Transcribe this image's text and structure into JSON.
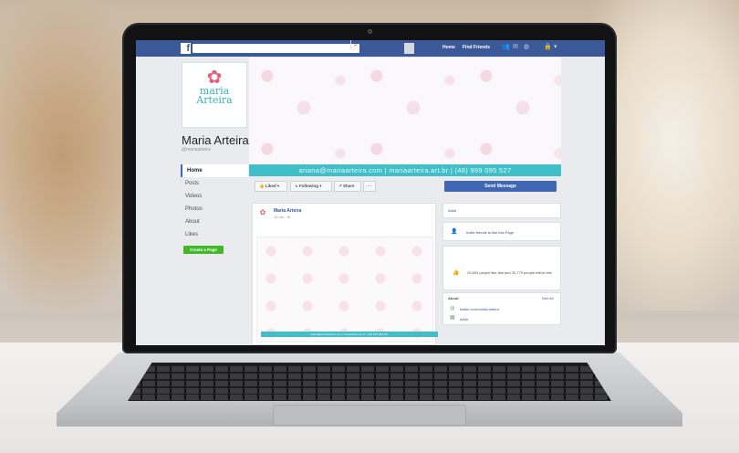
{
  "facebook": {
    "logo": "f",
    "search_placeholder": "",
    "nav": {
      "home": "Home",
      "find_friends": "Find Friends"
    },
    "icons": [
      "search-icon",
      "friend-requests-icon",
      "messages-icon",
      "notifications-icon",
      "lock-icon",
      "dropdown-icon"
    ]
  },
  "page": {
    "brand_line1": "maria",
    "brand_line2": "Arteira",
    "name": "Maria Arteira",
    "handle": "@mariaarteira",
    "contact_line": "ariana@mariaarteira.com  |  mariaarteira.art.br  |  (48) 999 095 527"
  },
  "sidebar": {
    "items": [
      {
        "label": "Home",
        "active": true
      },
      {
        "label": "Posts"
      },
      {
        "label": "Videos"
      },
      {
        "label": "Photos"
      },
      {
        "label": "About"
      },
      {
        "label": "Likes"
      }
    ],
    "create_page": "Create a Page"
  },
  "actions": {
    "liked": "Liked ▾",
    "following": "Following ▾",
    "share": "Share",
    "more": "···",
    "send_message": "Send Message"
  },
  "post": {
    "author": "Maria Arteira",
    "time": "10 hrs · ⊕",
    "band_text": "ariana@mariaarteira.com  |  mariaarteira.art.br  |  (48) 999 095 527"
  },
  "right": {
    "category": "Artist",
    "invite": "Invite friends to like this Page",
    "likes_text": "20,803 people like this and 20,779 people follow this",
    "about_title": "About",
    "see_all": "See All",
    "twitter": "twitter.com/maria.arteira",
    "about_category": "Artist"
  }
}
